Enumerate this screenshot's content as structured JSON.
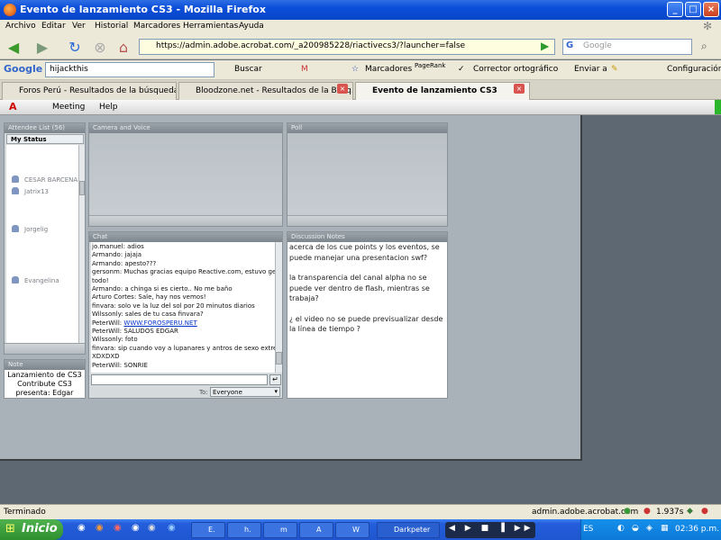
{
  "window": {
    "title": "Evento de lanzamiento CS3 - Mozilla Firefox",
    "btn_min": "_",
    "btn_max": "□",
    "btn_close": "×"
  },
  "menu": [
    "Archivo",
    "Editar",
    "Ver",
    "Historial",
    "Marcadores",
    "Herramientas",
    "Ayuda"
  ],
  "nav": {
    "url": "https://admin.adobe.acrobat.com/_a200985228/riactivecs3/?launcher=false",
    "search_placeholder": "Google"
  },
  "google_bar": {
    "logo": "Google",
    "query": "hijackthis",
    "buscar": "Buscar",
    "marcadores": "Marcadores",
    "pagerank": "PageRank",
    "corrector": "Corrector ortográfico",
    "enviar": "Enviar a",
    "config": "Configuración"
  },
  "tabs": [
    {
      "label": "Foros Perú - Resultados de la búsqueda"
    },
    {
      "label": "Bloodzone.net - Resultados de la Búsq..."
    },
    {
      "label": "Evento de lanzamiento CS3"
    }
  ],
  "app": {
    "menu_meeting": "Meeting",
    "menu_help": "Help"
  },
  "pods": {
    "attendee_title": "Attendee List (56)",
    "my_status": "My Status",
    "camera_title": "Camera and Voice",
    "poll_title": "Poll",
    "chat_title": "Chat",
    "discussion_title": "Discussion Notes",
    "note_title": "Note"
  },
  "attendees": [
    "CESAR BARCENA",
    "Jatrix13",
    "Jorgelig",
    "Evangelina"
  ],
  "chat": {
    "lines": [
      "jo.manuel: adios",
      "Armando: jajaja",
      "Armando: apesto???",
      "gersonm: Muchas gracias equipo Reactive.com, estuvo genial",
      "todo!",
      "Armando: a chinga si es cierto.. No me baño",
      "Arturo Cortes: Sale, hay nos vemos!",
      "finvara: solo ve la luz del sol por 20 minutos diarios",
      "Wilssonly: sales de tu casa finvara?",
      "PeterWill: WWW.FOROSPERU.NET",
      "PeterWill: SALUDOS EDGAR",
      "Wilssonly: foto",
      "finvara: sip cuando voy a lupanares y antros de sexo extremo",
      "XDXDXD",
      "PeterWill: SONRIE"
    ],
    "to_label": "To:",
    "to_value": "Everyone"
  },
  "discussion": [
    "acerca de los cue points y los eventos, se puede manejar una presentacion swf?",
    "la transparencia del canal alpha no se puede ver dentro de flash, mientras se trabaja?",
    "¿ el video no se puede previsualizar desde la línea de tiempo ?"
  ],
  "note": "Lanzamiento de CS3 Contribute CS3 presenta: Edgar",
  "statusbar": {
    "left": "Terminado",
    "domain": "admin.adobe.acrobat.com",
    "time": "1.937s"
  },
  "taskbar": {
    "start": "Inicio",
    "buttons": [
      "E.",
      "h.",
      "m",
      "A",
      "W",
      "Darkpeter"
    ],
    "lang": "ES",
    "clock": "02:36 p.m."
  }
}
